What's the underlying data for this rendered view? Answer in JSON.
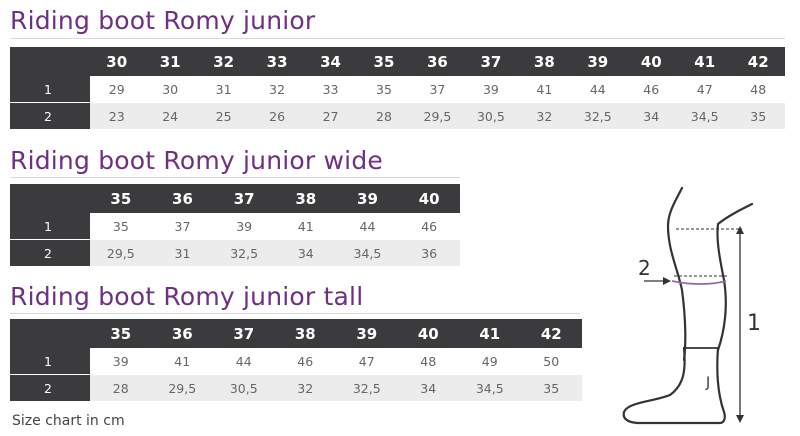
{
  "charts": [
    {
      "title": "Riding boot Romy junior",
      "sizes": [
        "30",
        "31",
        "32",
        "33",
        "34",
        "35",
        "36",
        "37",
        "38",
        "39",
        "40",
        "41",
        "42"
      ],
      "rows": [
        {
          "label": "1",
          "values": [
            "29",
            "30",
            "31",
            "32",
            "33",
            "35",
            "37",
            "39",
            "41",
            "44",
            "46",
            "47",
            "48"
          ]
        },
        {
          "label": "2",
          "values": [
            "23",
            "24",
            "25",
            "26",
            "27",
            "28",
            "29,5",
            "30,5",
            "32",
            "32,5",
            "34",
            "34,5",
            "35"
          ]
        }
      ]
    },
    {
      "title": "Riding boot Romy junior wide",
      "sizes": [
        "35",
        "36",
        "37",
        "38",
        "39",
        "40"
      ],
      "rows": [
        {
          "label": "1",
          "values": [
            "35",
            "37",
            "39",
            "41",
            "44",
            "46"
          ]
        },
        {
          "label": "2",
          "values": [
            "29,5",
            "31",
            "32,5",
            "34",
            "34,5",
            "36"
          ]
        }
      ]
    },
    {
      "title": "Riding boot Romy junior tall",
      "sizes": [
        "35",
        "36",
        "37",
        "38",
        "39",
        "40",
        "41",
        "42"
      ],
      "rows": [
        {
          "label": "1",
          "values": [
            "39",
            "41",
            "44",
            "46",
            "47",
            "48",
            "49",
            "50"
          ]
        },
        {
          "label": "2",
          "values": [
            "28",
            "29,5",
            "30,5",
            "32",
            "32,5",
            "34",
            "34,5",
            "35"
          ]
        }
      ]
    }
  ],
  "footnote": "Size chart in cm",
  "diagram": {
    "label_height": "1",
    "label_calf": "2",
    "label_boot": "J"
  },
  "colors": {
    "title": "#6f2f83",
    "header_bg": "#3b3b3d",
    "alt_row_bg": "#ececec",
    "calf_line": "#9a6aa8"
  }
}
